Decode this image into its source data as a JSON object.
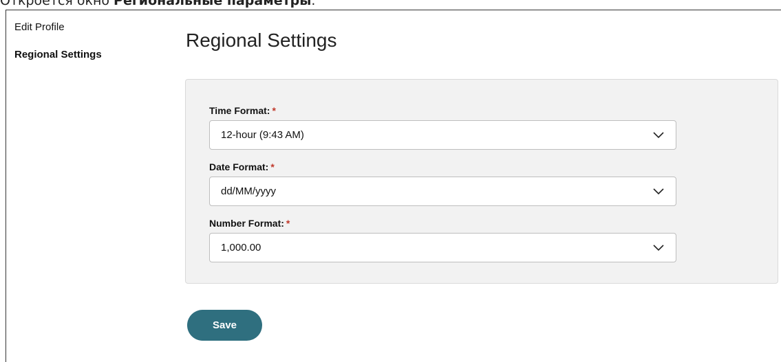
{
  "doc_caption": {
    "prefix": "Откроется окно ",
    "bold": "Региональные параметры",
    "suffix": "."
  },
  "sidebar": {
    "items": [
      {
        "label": "Edit Profile"
      },
      {
        "label": "Regional Settings"
      }
    ]
  },
  "main": {
    "title": "Regional Settings",
    "fields": [
      {
        "label": "Time Format:",
        "required": "*",
        "value": "12-hour (9:43 AM)"
      },
      {
        "label": "Date Format:",
        "required": "*",
        "value": "dd/MM/yyyy"
      },
      {
        "label": "Number Format:",
        "required": "*",
        "value": "1,000.00"
      }
    ],
    "save_label": "Save"
  },
  "colors": {
    "accent": "#2f6f7f",
    "required": "#c0392b",
    "panel_bg": "#f2f2f2"
  },
  "icons": {
    "dropdown": "chevron-down-icon"
  }
}
